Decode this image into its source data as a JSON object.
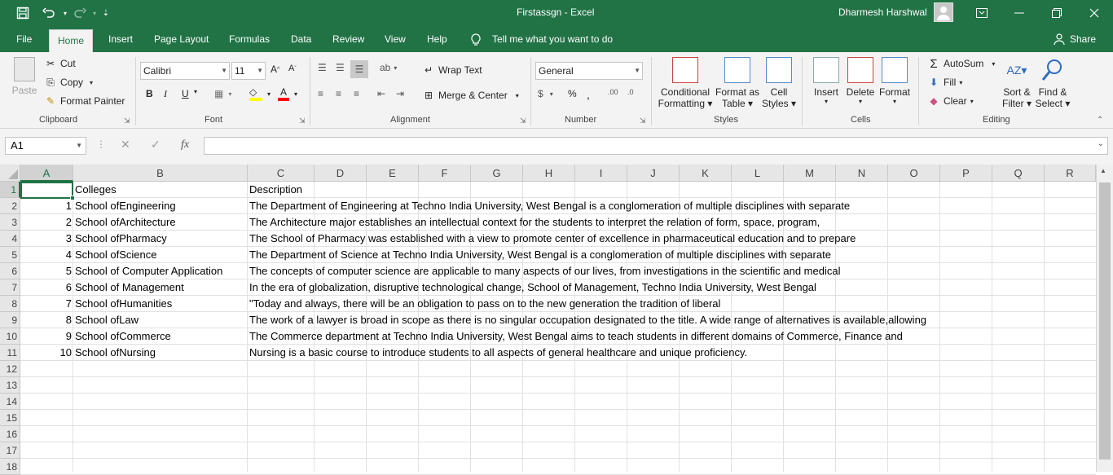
{
  "window": {
    "title": "Firstassgn  -  Excel",
    "user": "Dharmesh Harshwal",
    "quick_access": [
      "save-icon",
      "undo-icon",
      "redo-icon",
      "customize-icon"
    ]
  },
  "tabs": [
    "File",
    "Home",
    "Insert",
    "Page Layout",
    "Formulas",
    "Data",
    "Review",
    "View",
    "Help"
  ],
  "active_tab": "Home",
  "tell_me": "Tell me what you want to do",
  "share": "Share",
  "ribbon": {
    "clipboard": {
      "label": "Clipboard",
      "paste": "Paste",
      "cut": "Cut",
      "copy": "Copy",
      "format_painter": "Format Painter"
    },
    "font": {
      "label": "Font",
      "name": "Calibri",
      "size": "11",
      "bold": "B",
      "italic": "I",
      "underline": "U"
    },
    "alignment": {
      "label": "Alignment",
      "wrap_text": "Wrap Text",
      "merge_center": "Merge & Center"
    },
    "number": {
      "label": "Number",
      "format": "General",
      "percent": "%"
    },
    "styles": {
      "label": "Styles",
      "conditional_1": "Conditional",
      "conditional_2": "Formatting",
      "format_table_1": "Format as",
      "format_table_2": "Table",
      "cell_styles_1": "Cell",
      "cell_styles_2": "Styles"
    },
    "cells": {
      "label": "Cells",
      "insert": "Insert",
      "delete": "Delete",
      "format": "Format"
    },
    "editing": {
      "label": "Editing",
      "autosum": "AutoSum",
      "fill": "Fill",
      "clear": "Clear",
      "sort_1": "Sort &",
      "sort_2": "Filter",
      "find_1": "Find &",
      "find_2": "Select"
    }
  },
  "formula_bar": {
    "name_box": "A1",
    "fx": "fx",
    "content": ""
  },
  "columns": [
    "A",
    "B",
    "C",
    "D",
    "E",
    "F",
    "G",
    "H",
    "I",
    "J",
    "K",
    "L",
    "M",
    "N",
    "O",
    "P",
    "Q",
    "R"
  ],
  "row_numbers": [
    "1",
    "2",
    "3",
    "4",
    "5",
    "6",
    "7",
    "8",
    "9",
    "10",
    "11",
    "12",
    "13",
    "14",
    "15",
    "16",
    "17",
    "18"
  ],
  "sheet": {
    "header": {
      "b": "Colleges",
      "c": "Description"
    },
    "rows": [
      {
        "a": "1",
        "b": "School ofEngineering",
        "c": "The Department of Engineering at Techno India University, West Bengal is a conglomeration of multiple disciplines with separate"
      },
      {
        "a": "2",
        "b": "School ofArchitecture",
        "c": "The Architecture major establishes an intellectual context for the students to interpret the relation of form, space, program,"
      },
      {
        "a": "3",
        "b": "School ofPharmacy",
        "c": "The School of Pharmacy was established with a view to promote center of excellence in pharmaceutical education and to prepare"
      },
      {
        "a": "4",
        "b": "School ofScience",
        "c": "The Department of Science at Techno India University, West Bengal is a conglomeration of multiple disciplines with separate"
      },
      {
        "a": "5",
        "b": "School of Computer Application",
        "c": "The concepts of computer science are applicable to many aspects of our lives, from investigations in the scientific and medical"
      },
      {
        "a": "6",
        "b": "School of Management",
        "c": "In the era of globalization, disruptive technological change, School of Management, Techno India University, West Bengal"
      },
      {
        "a": "7",
        "b": "School ofHumanities",
        "c": "\"Today and always, there will be an obligation to pass on to the new generation the tradition of liberal"
      },
      {
        "a": "8",
        "b": "School ofLaw",
        "c": "The work of a lawyer is broad in scope as there is no singular occupation designated to the title. A wide range of alternatives is available,allowing"
      },
      {
        "a": "9",
        "b": "School ofCommerce",
        "c": "The Commerce department at Techno India University, West Bengal aims to teach students in different domains of Commerce, Finance and"
      },
      {
        "a": "10",
        "b": "School ofNursing",
        "c": "Nursing is a basic course to introduce students to all aspects of general healthcare and unique proficiency."
      }
    ]
  },
  "colors": {
    "accent": "#217346",
    "ribbon_bg": "#f3f3f3",
    "header_bg": "#e6e6e6"
  }
}
